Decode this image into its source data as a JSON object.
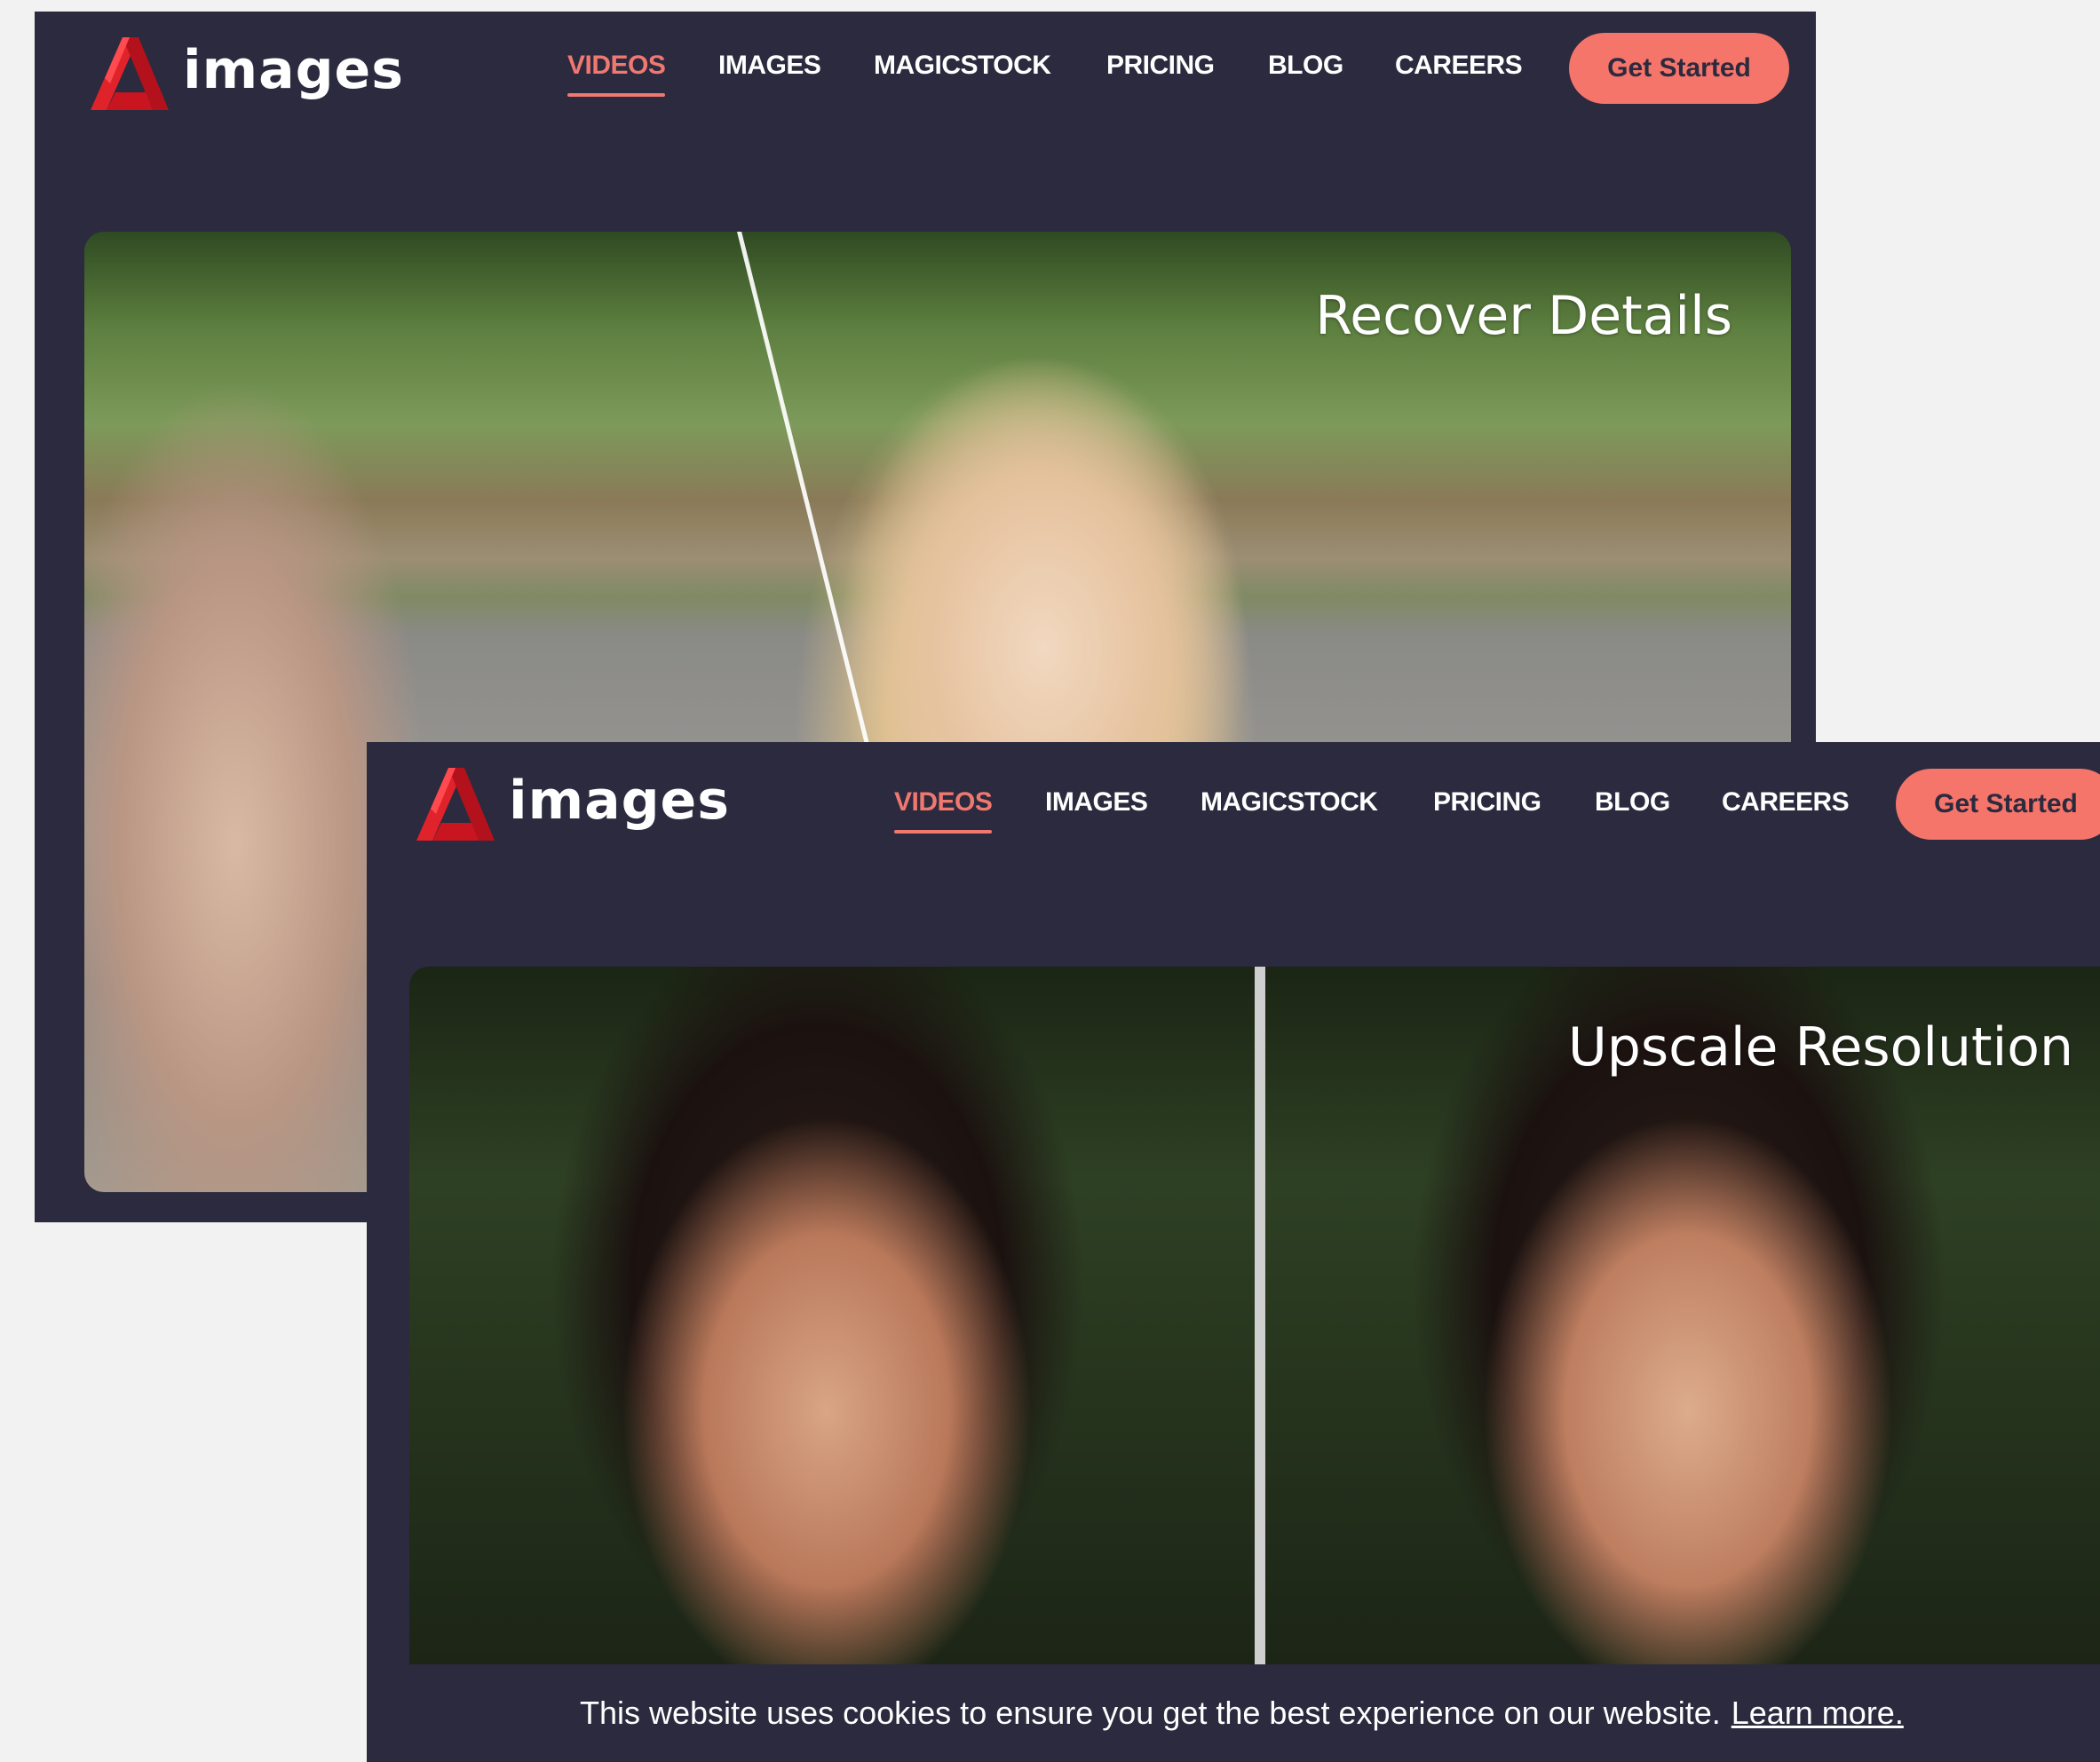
{
  "screens": [
    {
      "logo_text": "images",
      "nav": [
        "VIDEOS",
        "IMAGES",
        "MAGICSTOCK",
        "PRICING",
        "BLOG",
        "CAREERS"
      ],
      "active_nav": "VIDEOS",
      "cta_label": "Get Started",
      "hero_label": "Recover Details"
    },
    {
      "logo_text": "images",
      "nav": [
        "VIDEOS",
        "IMAGES",
        "MAGICSTOCK",
        "PRICING",
        "BLOG",
        "CAREERS"
      ],
      "active_nav": "VIDEOS",
      "cta_label": "Get Started",
      "hero_label": "Upscale Resolution",
      "cookie_text": "This website uses cookies to ensure you get the best experience on our website.",
      "cookie_link": "Learn more."
    }
  ],
  "colors": {
    "background": "#2b2a3e",
    "accent": "#f5756a",
    "active_nav": "#f07870",
    "logo_red": "#e0222b"
  }
}
